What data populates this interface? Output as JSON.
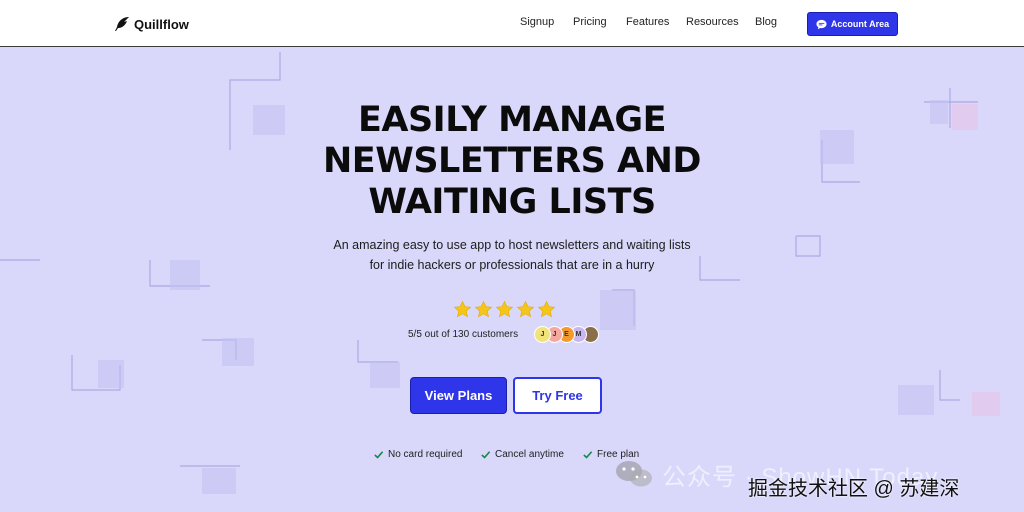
{
  "nav": {
    "brand": "Quillflow",
    "links": [
      "Signup",
      "Pricing",
      "Features",
      "Resources",
      "Blog"
    ],
    "account_button": "Account Area",
    "account_icon": "chat-bubble-icon"
  },
  "hero": {
    "title_lines": [
      "EASILY MANAGE",
      "NEWSLETTERS AND",
      "WAITING LISTS"
    ],
    "subtitle_lines": [
      "An amazing easy to use app to host newsletters and waiting lists",
      "for indie hackers or professionals that are in a hurry"
    ]
  },
  "rating": {
    "stars": 5,
    "star_color": "#f5c518",
    "text": "5/5 out of 130 customers",
    "avatars": [
      {
        "initial": "J",
        "color": "#f2e27a"
      },
      {
        "initial": "J",
        "color": "#f4a9a0"
      },
      {
        "initial": "E",
        "color": "#f39a2c"
      },
      {
        "initial": "M",
        "color": "#c7b6f0"
      },
      {
        "initial": "",
        "color": "#8a6d4a"
      }
    ]
  },
  "cta": {
    "primary": "View Plans",
    "secondary": "Try Free"
  },
  "features": [
    "No card required",
    "Cancel anytime",
    "Free plan"
  ],
  "watermark": {
    "platform": "掘金技术社区 @ 苏建深",
    "handle": "公众号 · ShowHN Today"
  },
  "colors": {
    "accent": "#2f35e8",
    "background": "#d9d8fb",
    "check": "#1a8a4a"
  }
}
